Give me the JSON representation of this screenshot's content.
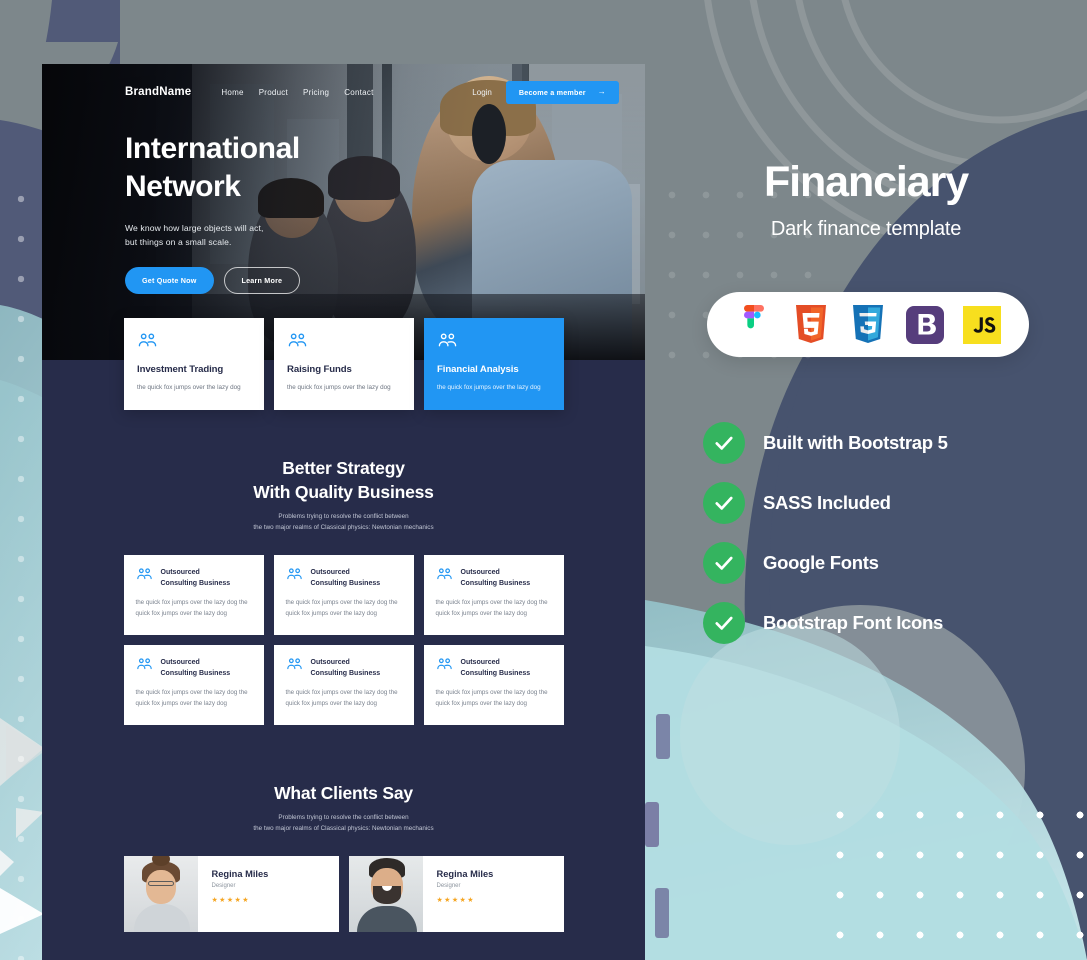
{
  "site": {
    "nav": {
      "brand": "BrandName",
      "links": [
        "Home",
        "Product",
        "Pricing",
        "Contact"
      ],
      "login_label": "Login",
      "cta_label": "Become a member",
      "cta_arrow": "→"
    },
    "hero": {
      "title_line1": "International",
      "title_line2": "Network",
      "paragraph_line1": "We know how large objects will act,",
      "paragraph_line2": "but things on a small scale.",
      "primary_button": "Get Quote Now",
      "secondary_button": "Learn More"
    },
    "services": [
      {
        "icon": "people-icon",
        "title": "Investment Trading",
        "text": "the quick fox jumps over the lazy dog",
        "accent": false
      },
      {
        "icon": "people-icon",
        "title": "Raising Funds",
        "text": "the quick fox jumps over the lazy dog",
        "accent": false
      },
      {
        "icon": "people-icon",
        "title": "Financial Analysis",
        "text": "the quick fox jumps over the lazy dog",
        "accent": true
      }
    ],
    "strategy": {
      "heading_line1": "Better Strategy",
      "heading_line2": "With Quality Business",
      "sub_line1": "Problems trying to resolve the conflict between",
      "sub_line2": "the two major realms of Classical physics: Newtonian mechanics",
      "cards": [
        {
          "icon": "people-icon",
          "title_line1": "Outsourced",
          "title_line2": "Consulting Business",
          "text": "the quick fox jumps over the lazy dog the quick fox jumps over the lazy dog"
        },
        {
          "icon": "people-icon",
          "title_line1": "Outsourced",
          "title_line2": "Consulting Business",
          "text": "the quick fox jumps over the lazy dog the quick fox jumps over the lazy dog"
        },
        {
          "icon": "people-icon",
          "title_line1": "Outsourced",
          "title_line2": "Consulting Business",
          "text": "the quick fox jumps over the lazy dog the quick fox jumps over the lazy dog"
        },
        {
          "icon": "people-icon",
          "title_line1": "Outsourced",
          "title_line2": "Consulting Business",
          "text": "the quick fox jumps over the lazy dog the quick fox jumps over the lazy dog"
        },
        {
          "icon": "people-icon",
          "title_line1": "Outsourced",
          "title_line2": "Consulting Business",
          "text": "the quick fox jumps over the lazy dog the quick fox jumps over the lazy dog"
        },
        {
          "icon": "people-icon",
          "title_line1": "Outsourced",
          "title_line2": "Consulting Business",
          "text": "the quick fox jumps over the lazy dog the quick fox jumps over the lazy dog"
        }
      ]
    },
    "testimonials": {
      "heading": "What Clients Say",
      "sub_line1": "Problems trying to resolve the conflict between",
      "sub_line2": "the two major realms of Classical physics: Newtonian mechanics",
      "items": [
        {
          "name": "Regina Miles",
          "role": "Designer",
          "stars": "★★★★★",
          "avatar": "woman-avatar"
        },
        {
          "name": "Regina Miles",
          "role": "Designer",
          "stars": "★★★★★",
          "avatar": "man-avatar"
        }
      ]
    }
  },
  "promo": {
    "title": "Financiary",
    "subtitle": "Dark finance template",
    "tech_chips": [
      {
        "name": "figma-icon",
        "label": "Figma"
      },
      {
        "name": "html5-icon",
        "label": "HTML5"
      },
      {
        "name": "css3-icon",
        "label": "CSS3"
      },
      {
        "name": "bootstrap-icon",
        "label": "Bootstrap"
      },
      {
        "name": "javascript-icon",
        "label": "JS"
      }
    ],
    "features": [
      {
        "icon": "check-icon",
        "label": "Built with Bootstrap 5"
      },
      {
        "icon": "check-icon",
        "label": "SASS Included"
      },
      {
        "icon": "check-icon",
        "label": "Google Fonts"
      },
      {
        "icon": "check-icon",
        "label": "Bootstrap Font Icons"
      }
    ]
  },
  "colors": {
    "accent_blue": "#2196f3",
    "dark_navy": "#272c4a",
    "slate": "#47536e",
    "green_check": "#34b45f",
    "bg_grey": "#7d878b",
    "mint": "#a9d4da",
    "star_gold": "#f5a623"
  }
}
